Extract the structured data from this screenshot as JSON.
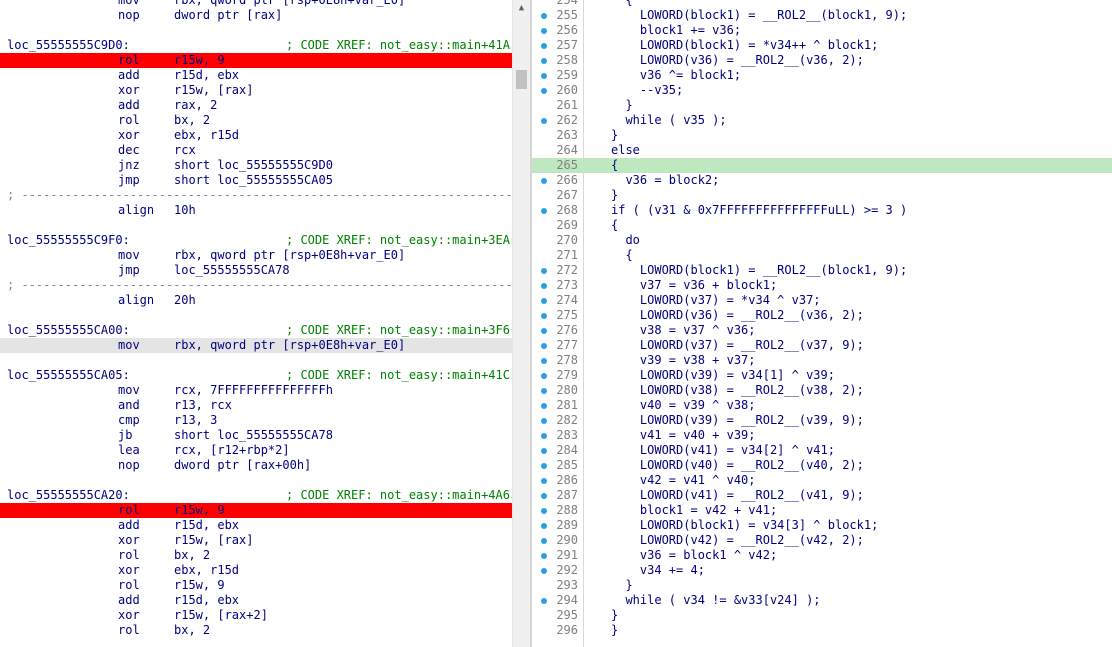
{
  "disassembly": {
    "lines": [
      {
        "kind": "ins",
        "mnemonic": "mov",
        "operands": "rbx, qword ptr [rsp+0E8h+var_E0]"
      },
      {
        "kind": "ins",
        "mnemonic": "nop",
        "operands": "dword ptr [rax]"
      },
      {
        "kind": "blank"
      },
      {
        "kind": "label",
        "label": "loc_55555555C9D0:",
        "comment": "; CODE XREF: not_easy::main+41A↓"
      },
      {
        "kind": "ins",
        "mnemonic": "rol",
        "operands": "r15w, 9",
        "highlight": "red"
      },
      {
        "kind": "ins",
        "mnemonic": "add",
        "operands": "r15d, ebx"
      },
      {
        "kind": "ins",
        "mnemonic": "xor",
        "operands": "r15w, [rax]"
      },
      {
        "kind": "ins",
        "mnemonic": "add",
        "operands": "rax, 2"
      },
      {
        "kind": "ins",
        "mnemonic": "rol",
        "operands": "bx, 2"
      },
      {
        "kind": "ins",
        "mnemonic": "xor",
        "operands": "ebx, r15d"
      },
      {
        "kind": "ins",
        "mnemonic": "dec",
        "operands": "rcx"
      },
      {
        "kind": "ins",
        "mnemonic": "jnz",
        "operands": "short loc_55555555C9D0"
      },
      {
        "kind": "ins",
        "mnemonic": "jmp",
        "operands": "short loc_55555555CA05"
      },
      {
        "kind": "sep",
        "text": "; ---------------------------------------------------------------------------"
      },
      {
        "kind": "ins",
        "mnemonic": "align",
        "operands": "10h"
      },
      {
        "kind": "blank"
      },
      {
        "kind": "label",
        "label": "loc_55555555C9F0:",
        "comment": "; CODE XREF: not_easy::main+3EA↑"
      },
      {
        "kind": "ins",
        "mnemonic": "mov",
        "operands": "rbx, qword ptr [rsp+0E8h+var_E0]"
      },
      {
        "kind": "ins",
        "mnemonic": "jmp",
        "operands": "loc_55555555CA78"
      },
      {
        "kind": "sep",
        "text": "; ---------------------------------------------------------------------------"
      },
      {
        "kind": "ins",
        "mnemonic": "align",
        "operands": "20h"
      },
      {
        "kind": "blank"
      },
      {
        "kind": "label",
        "label": "loc_55555555CA00:",
        "comment": "; CODE XREF: not_easy::main+3F6↑"
      },
      {
        "kind": "ins",
        "mnemonic": "mov",
        "operands": "rbx, qword ptr [rsp+0E8h+var_E0]",
        "highlight": "gray"
      },
      {
        "kind": "blank"
      },
      {
        "kind": "label",
        "label": "loc_55555555CA05:",
        "comment": "; CODE XREF: not_easy::main+41C↑"
      },
      {
        "kind": "ins",
        "mnemonic": "mov",
        "operands": "rcx, 7FFFFFFFFFFFFFFFh"
      },
      {
        "kind": "ins",
        "mnemonic": "and",
        "operands": "r13, rcx"
      },
      {
        "kind": "ins",
        "mnemonic": "cmp",
        "operands": "r13, 3"
      },
      {
        "kind": "ins",
        "mnemonic": "jb",
        "operands": "short loc_55555555CA78"
      },
      {
        "kind": "ins",
        "mnemonic": "lea",
        "operands": "rcx, [r12+rbp*2]"
      },
      {
        "kind": "ins",
        "mnemonic": "nop",
        "operands": "dword ptr [rax+00h]"
      },
      {
        "kind": "blank"
      },
      {
        "kind": "label",
        "label": "loc_55555555CA20:",
        "comment": "; CODE XREF: not_easy::main+4A6↓"
      },
      {
        "kind": "ins",
        "mnemonic": "rol",
        "operands": "r15w, 9",
        "highlight": "red"
      },
      {
        "kind": "ins",
        "mnemonic": "add",
        "operands": "r15d, ebx"
      },
      {
        "kind": "ins",
        "mnemonic": "xor",
        "operands": "r15w, [rax]"
      },
      {
        "kind": "ins",
        "mnemonic": "rol",
        "operands": "bx, 2"
      },
      {
        "kind": "ins",
        "mnemonic": "xor",
        "operands": "ebx, r15d"
      },
      {
        "kind": "ins",
        "mnemonic": "rol",
        "operands": "r15w, 9"
      },
      {
        "kind": "ins",
        "mnemonic": "add",
        "operands": "r15d, ebx"
      },
      {
        "kind": "ins",
        "mnemonic": "xor",
        "operands": "r15w, [rax+2]"
      },
      {
        "kind": "ins",
        "mnemonic": "rol",
        "operands": "bx, 2"
      }
    ]
  },
  "pseudocode": {
    "lines": [
      {
        "num": "254",
        "dot": false,
        "code": "  {"
      },
      {
        "num": "255",
        "dot": true,
        "code": "    LOWORD(block1) = __ROL2__(block1, 9);"
      },
      {
        "num": "256",
        "dot": true,
        "code": "    block1 += v36;"
      },
      {
        "num": "257",
        "dot": true,
        "code": "    LOWORD(block1) = *v34++ ^ block1;"
      },
      {
        "num": "258",
        "dot": true,
        "code": "    LOWORD(v36) = __ROL2__(v36, 2);"
      },
      {
        "num": "259",
        "dot": true,
        "code": "    v36 ^= block1;"
      },
      {
        "num": "260",
        "dot": true,
        "code": "    --v35;"
      },
      {
        "num": "261",
        "dot": false,
        "code": "  }"
      },
      {
        "num": "262",
        "dot": true,
        "code": "  while ( v35 );"
      },
      {
        "num": "263",
        "dot": false,
        "code": "}"
      },
      {
        "num": "264",
        "dot": false,
        "code": "else"
      },
      {
        "num": "265",
        "dot": false,
        "code": "{",
        "highlight": "green"
      },
      {
        "num": "266",
        "dot": true,
        "code": "  v36 = block2;"
      },
      {
        "num": "267",
        "dot": false,
        "code": "}"
      },
      {
        "num": "268",
        "dot": true,
        "code": "if ( (v31 & 0x7FFFFFFFFFFFFFFFuLL) >= 3 )"
      },
      {
        "num": "269",
        "dot": false,
        "code": "{"
      },
      {
        "num": "270",
        "dot": false,
        "code": "  do"
      },
      {
        "num": "271",
        "dot": false,
        "code": "  {"
      },
      {
        "num": "272",
        "dot": true,
        "code": "    LOWORD(block1) = __ROL2__(block1, 9);"
      },
      {
        "num": "273",
        "dot": true,
        "code": "    v37 = v36 + block1;"
      },
      {
        "num": "274",
        "dot": true,
        "code": "    LOWORD(v37) = *v34 ^ v37;"
      },
      {
        "num": "275",
        "dot": true,
        "code": "    LOWORD(v36) = __ROL2__(v36, 2);"
      },
      {
        "num": "276",
        "dot": true,
        "code": "    v38 = v37 ^ v36;"
      },
      {
        "num": "277",
        "dot": true,
        "code": "    LOWORD(v37) = __ROL2__(v37, 9);"
      },
      {
        "num": "278",
        "dot": true,
        "code": "    v39 = v38 + v37;"
      },
      {
        "num": "279",
        "dot": true,
        "code": "    LOWORD(v39) = v34[1] ^ v39;"
      },
      {
        "num": "280",
        "dot": true,
        "code": "    LOWORD(v38) = __ROL2__(v38, 2);"
      },
      {
        "num": "281",
        "dot": true,
        "code": "    v40 = v39 ^ v38;"
      },
      {
        "num": "282",
        "dot": true,
        "code": "    LOWORD(v39) = __ROL2__(v39, 9);"
      },
      {
        "num": "283",
        "dot": true,
        "code": "    v41 = v40 + v39;"
      },
      {
        "num": "284",
        "dot": true,
        "code": "    LOWORD(v41) = v34[2] ^ v41;"
      },
      {
        "num": "285",
        "dot": true,
        "code": "    LOWORD(v40) = __ROL2__(v40, 2);"
      },
      {
        "num": "286",
        "dot": true,
        "code": "    v42 = v41 ^ v40;"
      },
      {
        "num": "287",
        "dot": true,
        "code": "    LOWORD(v41) = __ROL2__(v41, 9);"
      },
      {
        "num": "288",
        "dot": true,
        "code": "    block1 = v42 + v41;"
      },
      {
        "num": "289",
        "dot": true,
        "code": "    LOWORD(block1) = v34[3] ^ block1;"
      },
      {
        "num": "290",
        "dot": true,
        "code": "    LOWORD(v42) = __ROL2__(v42, 2);"
      },
      {
        "num": "291",
        "dot": true,
        "code": "    v36 = block1 ^ v42;"
      },
      {
        "num": "292",
        "dot": true,
        "code": "    v34 += 4;"
      },
      {
        "num": "293",
        "dot": false,
        "code": "  }"
      },
      {
        "num": "294",
        "dot": true,
        "code": "  while ( v34 != &v33[v24] );"
      },
      {
        "num": "295",
        "dot": false,
        "code": "}"
      },
      {
        "num": "296",
        "dot": false,
        "code": "}"
      }
    ]
  },
  "colors": {
    "breakpoint_red": "#ff0000",
    "current_line_gray": "#e4e4e4",
    "sync_green": "#c0e8c0",
    "code_navy": "#000080",
    "comment_green": "#008000",
    "dot_blue": "#2b9fe0"
  },
  "icons": {
    "scroll_up": "triangle-up-icon"
  }
}
